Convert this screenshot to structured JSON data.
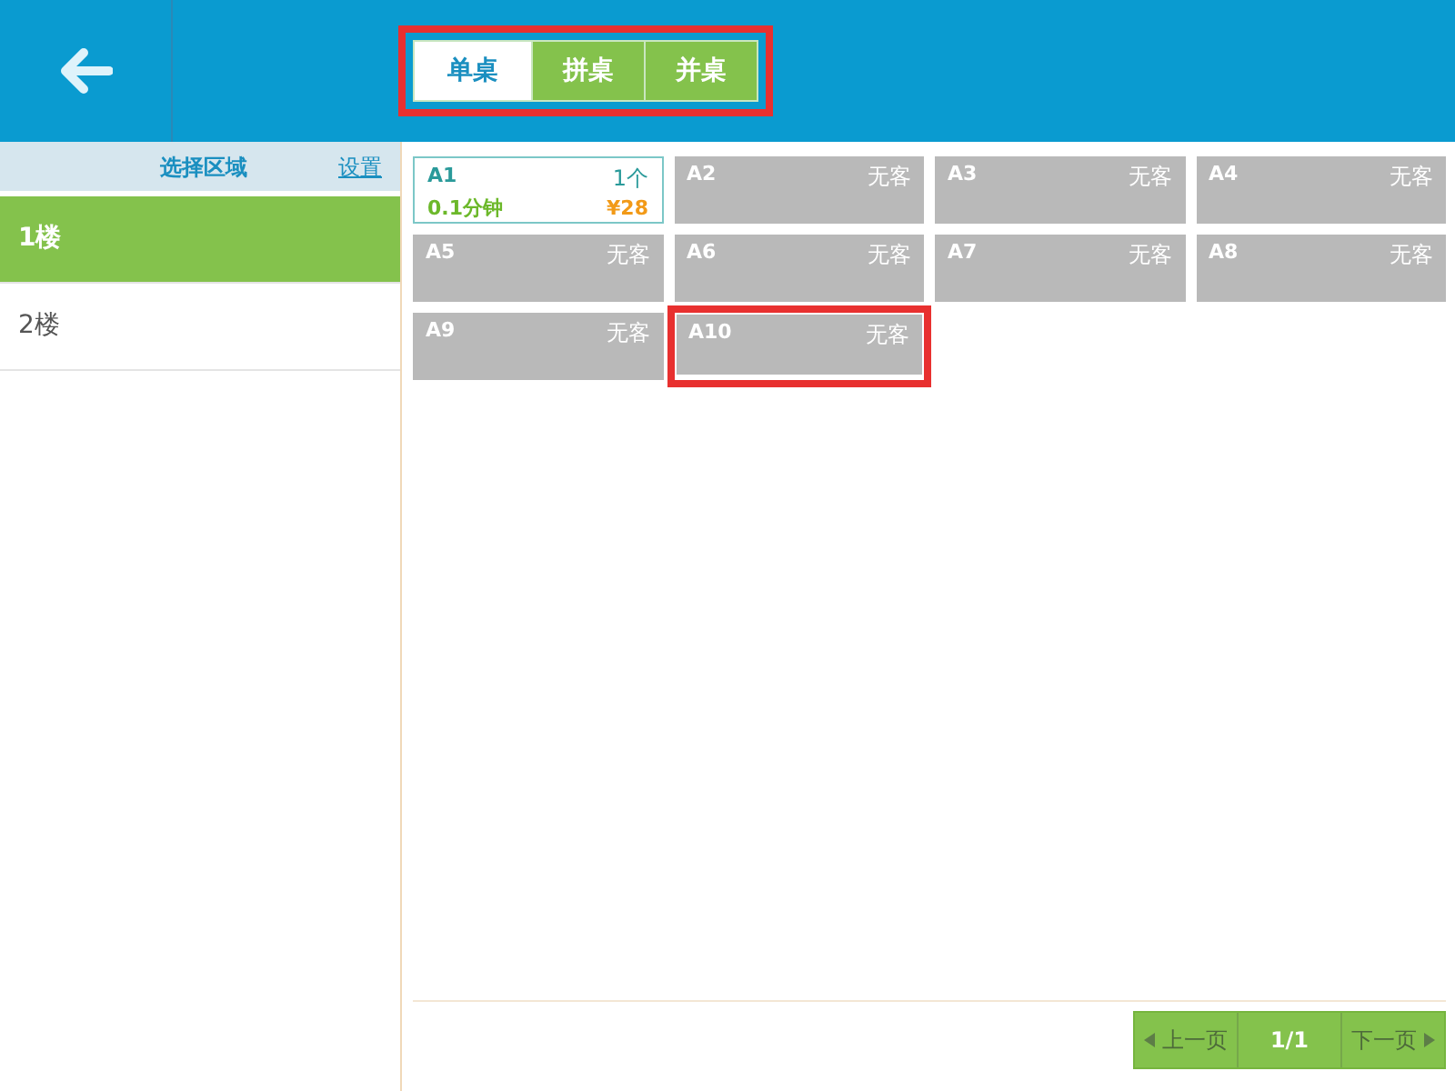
{
  "modes": [
    {
      "label": "单桌",
      "selected": true
    },
    {
      "label": "拼桌",
      "selected": false
    },
    {
      "label": "并桌",
      "selected": false
    }
  ],
  "modes_highlighted": true,
  "sidebar": {
    "title": "选择区域",
    "settings_link": "设置",
    "items": [
      {
        "label": "1楼",
        "selected": true
      },
      {
        "label": "2楼",
        "selected": false
      }
    ]
  },
  "tables": [
    {
      "name": "A1",
      "kind": "occupied",
      "guests": "1个",
      "duration": "0.1分钟",
      "amount": "¥28",
      "highlighted": false
    },
    {
      "name": "A2",
      "kind": "free",
      "status": "无客",
      "highlighted": false
    },
    {
      "name": "A3",
      "kind": "free",
      "status": "无客",
      "highlighted": false
    },
    {
      "name": "A4",
      "kind": "free",
      "status": "无客",
      "highlighted": false
    },
    {
      "name": "A5",
      "kind": "free",
      "status": "无客",
      "highlighted": false
    },
    {
      "name": "A6",
      "kind": "free",
      "status": "无客",
      "highlighted": false
    },
    {
      "name": "A7",
      "kind": "free",
      "status": "无客",
      "highlighted": false
    },
    {
      "name": "A8",
      "kind": "free",
      "status": "无客",
      "highlighted": false
    },
    {
      "name": "A9",
      "kind": "free",
      "status": "无客",
      "highlighted": false
    },
    {
      "name": "A10",
      "kind": "free",
      "status": "无客",
      "highlighted": true
    }
  ],
  "pager": {
    "prev": "上一页",
    "page": "1/1",
    "next": "下一页"
  }
}
